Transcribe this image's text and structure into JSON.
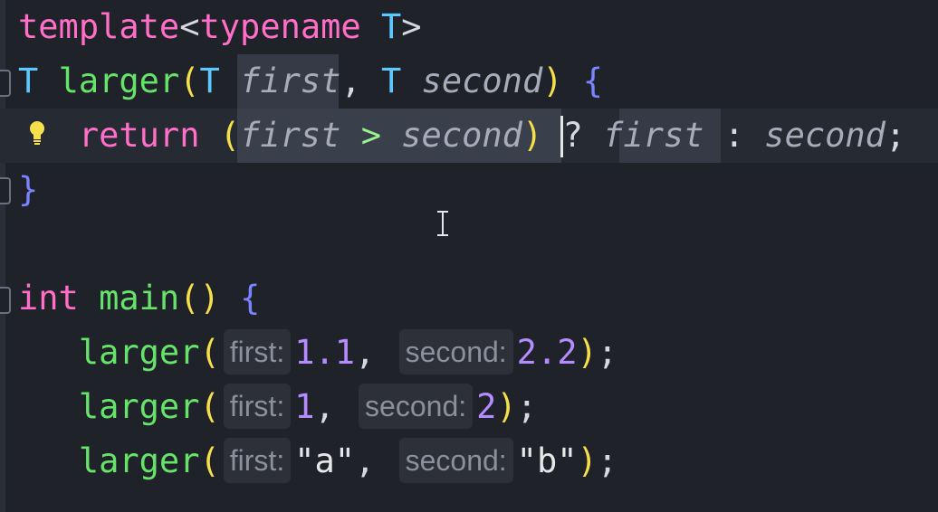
{
  "editor": {
    "lines": [
      {
        "id": "template-decl",
        "tokens": [
          {
            "text": "template",
            "cls": "kw"
          },
          {
            "text": "<",
            "cls": "punct"
          },
          {
            "text": "typename",
            "cls": "kw"
          },
          {
            "text": " ",
            "cls": ""
          },
          {
            "text": "T",
            "cls": "type"
          },
          {
            "text": ">",
            "cls": "punct"
          }
        ]
      },
      {
        "id": "function-signature",
        "tokens": [
          {
            "text": "T",
            "cls": "type"
          },
          {
            "text": " ",
            "cls": ""
          },
          {
            "text": "larger",
            "cls": "fn"
          },
          {
            "text": "(",
            "cls": "paren-y"
          },
          {
            "text": "T",
            "cls": "type"
          },
          {
            "text": " ",
            "cls": ""
          },
          {
            "text": "first",
            "cls": "param"
          },
          {
            "text": ", ",
            "cls": "punct"
          },
          {
            "text": "T",
            "cls": "type"
          },
          {
            "text": " ",
            "cls": ""
          },
          {
            "text": "second",
            "cls": "param"
          },
          {
            "text": ")",
            "cls": "paren-y"
          },
          {
            "text": " ",
            "cls": ""
          },
          {
            "text": "{",
            "cls": "paren-b"
          }
        ]
      },
      {
        "id": "return-statement",
        "tokens": [
          {
            "text": "   ",
            "cls": ""
          },
          {
            "text": "return",
            "cls": "kw"
          },
          {
            "text": " ",
            "cls": ""
          },
          {
            "text": "(",
            "cls": "paren-y"
          },
          {
            "text": "first",
            "cls": "param"
          },
          {
            "text": " ",
            "cls": ""
          },
          {
            "text": ">",
            "cls": "op"
          },
          {
            "text": " ",
            "cls": ""
          },
          {
            "text": "second",
            "cls": "param"
          },
          {
            "text": ")",
            "cls": "paren-y"
          },
          {
            "text": " ",
            "cls": ""
          },
          {
            "text": "?",
            "cls": "punct"
          },
          {
            "text": " ",
            "cls": ""
          },
          {
            "text": "first",
            "cls": "param"
          },
          {
            "text": " ",
            "cls": ""
          },
          {
            "text": ":",
            "cls": "punct"
          },
          {
            "text": " ",
            "cls": ""
          },
          {
            "text": "second",
            "cls": "param"
          },
          {
            "text": ";",
            "cls": "punct"
          }
        ]
      },
      {
        "id": "function-close",
        "tokens": [
          {
            "text": "}",
            "cls": "paren-b"
          }
        ]
      },
      {
        "id": "blank",
        "tokens": []
      },
      {
        "id": "main-signature",
        "tokens": [
          {
            "text": "int",
            "cls": "kw"
          },
          {
            "text": " ",
            "cls": ""
          },
          {
            "text": "main",
            "cls": "fn"
          },
          {
            "text": "()",
            "cls": "paren-y"
          },
          {
            "text": " ",
            "cls": ""
          },
          {
            "text": "{",
            "cls": "paren-b"
          }
        ]
      },
      {
        "id": "call-1",
        "tokens": [
          {
            "text": "   ",
            "cls": ""
          },
          {
            "text": "larger",
            "cls": "fn"
          },
          {
            "text": "(",
            "cls": "paren-y"
          },
          {
            "text": "first:",
            "cls": "hint"
          },
          {
            "text": "1.1",
            "cls": "num"
          },
          {
            "text": ", ",
            "cls": "punct"
          },
          {
            "text": "second:",
            "cls": "hint"
          },
          {
            "text": "2.2",
            "cls": "num"
          },
          {
            "text": ")",
            "cls": "paren-y"
          },
          {
            "text": ";",
            "cls": "punct"
          }
        ]
      },
      {
        "id": "call-2",
        "tokens": [
          {
            "text": "   ",
            "cls": ""
          },
          {
            "text": "larger",
            "cls": "fn"
          },
          {
            "text": "(",
            "cls": "paren-y"
          },
          {
            "text": "first:",
            "cls": "hint"
          },
          {
            "text": "1",
            "cls": "num"
          },
          {
            "text": ", ",
            "cls": "punct"
          },
          {
            "text": "second:",
            "cls": "hint"
          },
          {
            "text": "2",
            "cls": "num"
          },
          {
            "text": ")",
            "cls": "paren-y"
          },
          {
            "text": ";",
            "cls": "punct"
          }
        ]
      },
      {
        "id": "call-3",
        "tokens": [
          {
            "text": "   ",
            "cls": ""
          },
          {
            "text": "larger",
            "cls": "fn"
          },
          {
            "text": "(",
            "cls": "paren-y"
          },
          {
            "text": "first:",
            "cls": "hint"
          },
          {
            "text": "\"a\"",
            "cls": "str"
          },
          {
            "text": ", ",
            "cls": "punct"
          },
          {
            "text": "second:",
            "cls": "hint"
          },
          {
            "text": "\"b\"",
            "cls": "str"
          },
          {
            "text": ")",
            "cls": "paren-y"
          },
          {
            "text": ";",
            "cls": "punct"
          }
        ]
      }
    ],
    "icons": {
      "bulb": "lightbulb-icon",
      "fold": "fold-icon",
      "mouse": "text-cursor-icon"
    },
    "colors": {
      "background": "#1f2229",
      "keyword": "#ff6ec7",
      "type": "#5cc8ff",
      "function": "#66e46a",
      "parameter": "#a7abba",
      "number": "#b58cff",
      "bulb": "#f5e04b"
    }
  }
}
